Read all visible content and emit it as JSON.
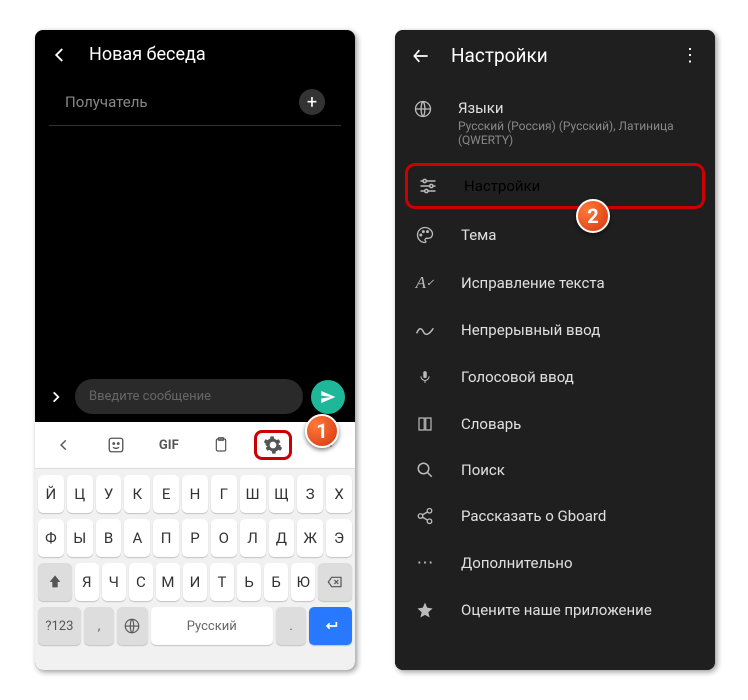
{
  "left": {
    "header": "Новая беседа",
    "recipient_placeholder": "Получатель",
    "msg_placeholder": "Введите сообщение",
    "toolbar": {
      "gif": "GIF"
    },
    "keyboard": {
      "row1": [
        "Й",
        "Ц",
        "У",
        "К",
        "Е",
        "Н",
        "Г",
        "Ш",
        "Щ",
        "З",
        "Х"
      ],
      "row2": [
        "Ф",
        "Ы",
        "В",
        "А",
        "П",
        "Р",
        "О",
        "Л",
        "Д",
        "Ж",
        "Э"
      ],
      "row3": [
        "Я",
        "Ч",
        "С",
        "М",
        "И",
        "Т",
        "Ь",
        "Б",
        "Ю"
      ],
      "lang_key": "?123",
      "space": "Русский",
      "comma": ",",
      "period": "."
    }
  },
  "right": {
    "header": "Настройки",
    "items": {
      "langs_title": "Языки",
      "langs_sub": "Русский (Россия) (Русский), Латиница (QWERTY)",
      "settings": "Настройки",
      "theme": "Тема",
      "correction": "Исправление текста",
      "glide": "Непрерывный ввод",
      "voice": "Голосовой ввод",
      "dict": "Словарь",
      "search": "Поиск",
      "share": "Рассказать о Gboard",
      "advanced": "Дополнительно",
      "rate": "Оцените наше приложение"
    }
  },
  "badges": {
    "one": "1",
    "two": "2"
  }
}
